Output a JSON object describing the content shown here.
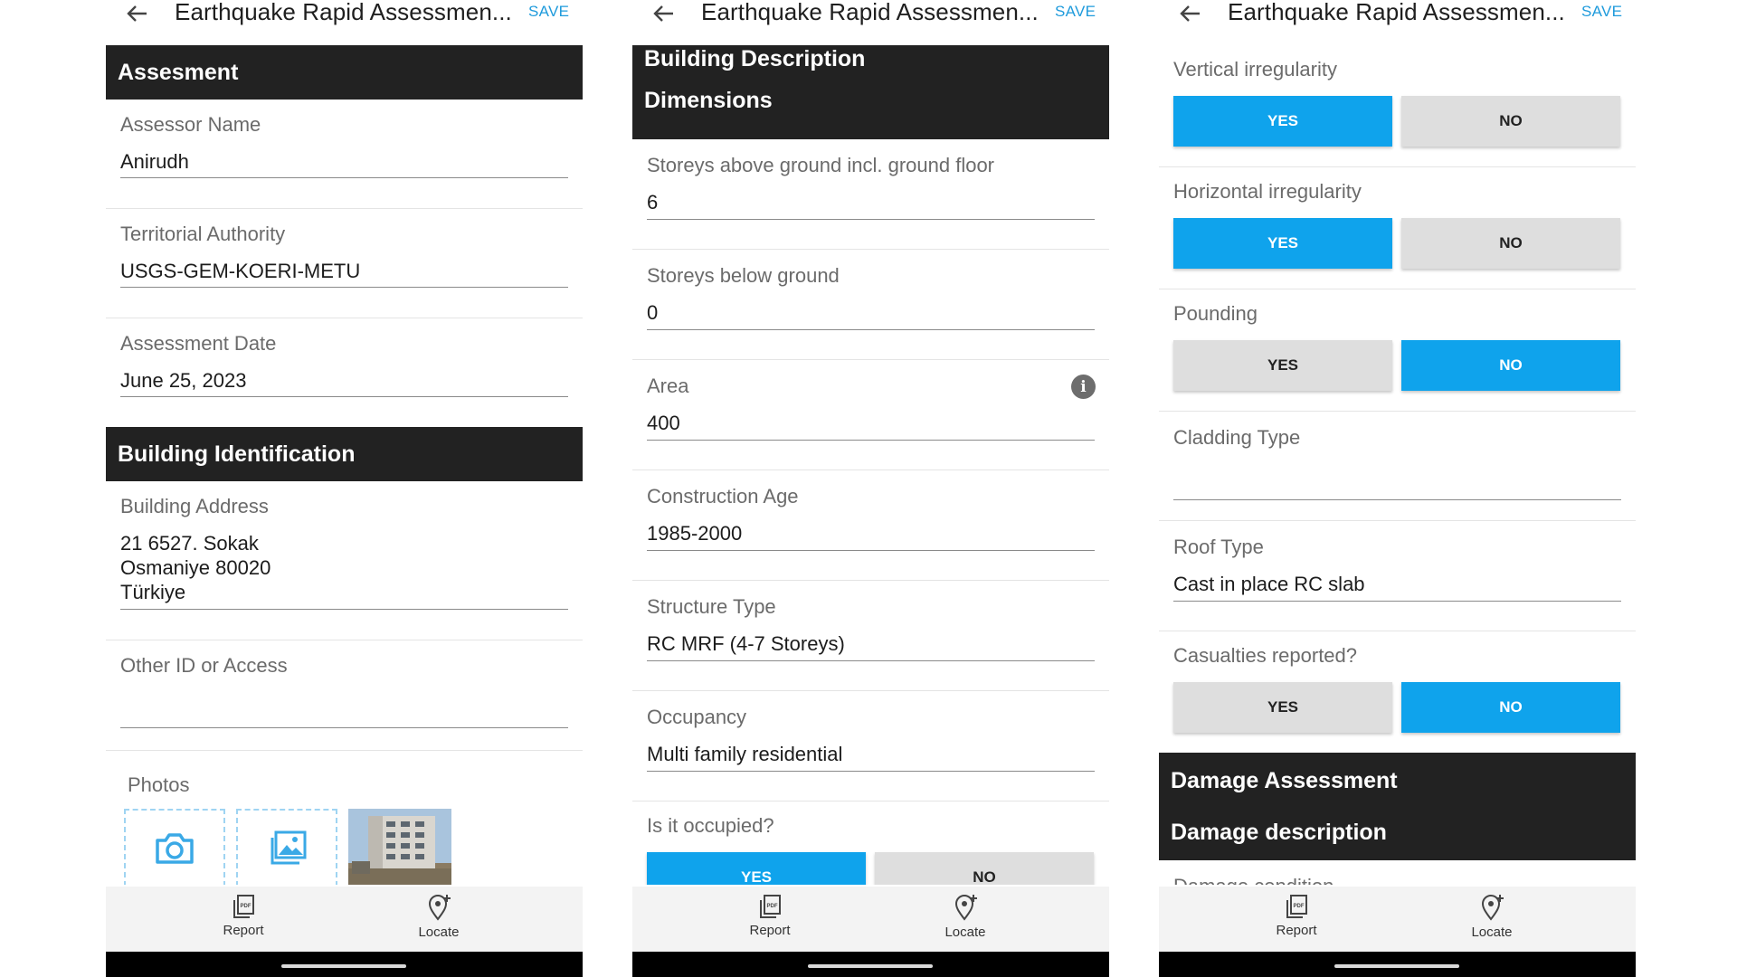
{
  "app": {
    "title": "Earthquake Rapid Assessmen...",
    "save": "SAVE"
  },
  "colors": {
    "accent": "#0fa3ec",
    "section": "#222222",
    "save": "#1f9bdc"
  },
  "nav": {
    "report": "Report",
    "locate": "Locate"
  },
  "screen1": {
    "assessment_header": "Assesment",
    "assessor_name": {
      "label": "Assessor Name",
      "value": "Anirudh"
    },
    "territorial_authority": {
      "label": "Territorial Authority",
      "value": "USGS-GEM-KOERI-METU"
    },
    "assessment_date": {
      "label": "Assessment Date",
      "value": "June 25, 2023"
    },
    "building_identification_header": "Building Identification",
    "building_address": {
      "label": "Building Address",
      "line1": "21 6527. Sokak",
      "line2": "Osmaniye 80020",
      "line3": "Türkiye"
    },
    "other_id": {
      "label": "Other ID or Access",
      "value": ""
    },
    "photos": {
      "label": "Photos",
      "camera_icon": "camera-icon",
      "gallery_icon": "gallery-icon"
    }
  },
  "screen2": {
    "header_line1": "Building Description",
    "header_line2": "Dimensions",
    "storeys_above": {
      "label": "Storeys above ground incl. ground floor",
      "value": "6"
    },
    "storeys_below": {
      "label": "Storeys below ground",
      "value": "0"
    },
    "area": {
      "label": "Area",
      "value": "400"
    },
    "construction_age": {
      "label": "Construction Age",
      "value": "1985-2000"
    },
    "structure_type": {
      "label": "Structure Type",
      "value": "RC MRF (4-7 Storeys)"
    },
    "occupancy": {
      "label": "Occupancy",
      "value": "Multi family residential"
    },
    "occupied": {
      "label": "Is it occupied?",
      "yes": "YES",
      "no": "NO",
      "selected": "YES"
    }
  },
  "screen3": {
    "vertical_irregularity": {
      "label": "Vertical irregularity",
      "yes": "YES",
      "no": "NO",
      "selected": "YES"
    },
    "horizontal_irregularity": {
      "label": "Horizontal irregularity",
      "yes": "YES",
      "no": "NO",
      "selected": "YES"
    },
    "pounding": {
      "label": "Pounding",
      "yes": "YES",
      "no": "NO",
      "selected": "NO"
    },
    "cladding_type": {
      "label": "Cladding Type",
      "value": ""
    },
    "roof_type": {
      "label": "Roof Type",
      "value": "Cast in place RC slab"
    },
    "casualties": {
      "label": "Casualties reported?",
      "yes": "YES",
      "no": "NO",
      "selected": "NO"
    },
    "header_line1": "Damage Assessment",
    "header_line2": "Damage description",
    "damage_condition": {
      "label": "Damage condition"
    }
  }
}
